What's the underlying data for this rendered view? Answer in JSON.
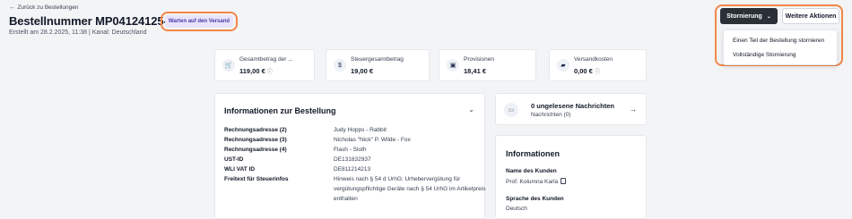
{
  "header": {
    "back_link": "Zurück zu Bestellungen",
    "title": "Bestellnummer MP04124125-00-A",
    "status_badge": "Warten auf den Versand",
    "created": "Erstellt am 28.2.2025, 11:38",
    "channel": "Kanal: Deutschland"
  },
  "actions": {
    "storno_label": "Stornierung",
    "more_label": "Weitere Aktionen",
    "menu": [
      "Einen Teil der Bestellung stornieren",
      "Vollständige Stornierung"
    ]
  },
  "stats": [
    {
      "label": "Gesamtbetrag der ...",
      "value": "119,00 €",
      "icon": "cart-icon",
      "info": true
    },
    {
      "label": "Steuergesamtbetrag",
      "value": "19,00 €",
      "icon": "tax-coin-icon",
      "info": false
    },
    {
      "label": "Provisionen",
      "value": "18,41 €",
      "icon": "money-icon",
      "info": false
    },
    {
      "label": "Versandkosten",
      "value": "0,00 €",
      "icon": "truck-icon",
      "info": true
    }
  ],
  "order_info": {
    "title": "Informationen zur Bestellung",
    "rows": [
      {
        "key": "Rechnungsadresse (2)",
        "value": "Judy Hopps - Rabbit"
      },
      {
        "key": "Rechnungsadresse (3)",
        "value": "Nicholas \"Nick\" P. Wilde - Fox"
      },
      {
        "key": "Rechnungsadresse (4)",
        "value": "Flash - Sloth"
      },
      {
        "key": "UST-ID",
        "value": "DE131832937"
      },
      {
        "key": "WLI VAT ID",
        "value": "DE811214213"
      },
      {
        "key": "Freitext für Steuerinfos",
        "value": "Hinweis nach § 54 d UrhG: Urhebervergütung für vergütungspflichtige Geräte nach § 54 UrhG im Artikelpreis enthalten"
      }
    ]
  },
  "messages": {
    "title": "0 ungelesene Nachrichten",
    "subtitle": "Nachrichten (0)"
  },
  "info_panel": {
    "title": "Informationen",
    "customer_label": "Name des Kunden",
    "customer_name": "Prof. Kolumna Karla",
    "language_label": "Sprache des Kunden",
    "language": "Deutsch"
  },
  "colors": {
    "accent_ring": "#f2874a",
    "badge_bg": "#e8e4fb",
    "badge_text": "#4b3aa7",
    "primary_button": "#2b2f36"
  }
}
